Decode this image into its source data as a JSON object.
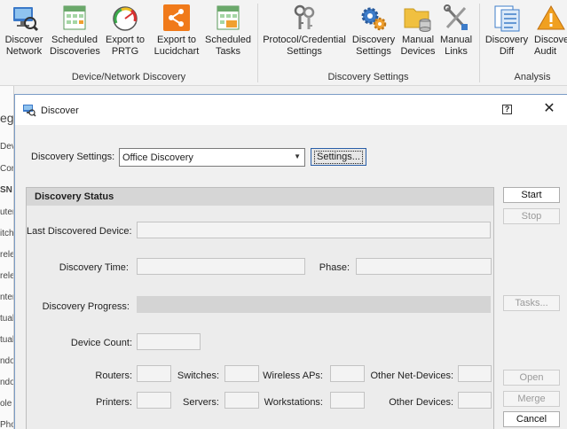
{
  "ribbon": {
    "buttons": [
      {
        "label": "Discover\nNetwork",
        "icon": "discover-network-icon"
      },
      {
        "label": "Scheduled\nDiscoveries",
        "icon": "scheduled-discoveries-icon"
      },
      {
        "label": "Export to\nPRTG",
        "icon": "prtg-gauge-icon"
      },
      {
        "label": "Export to\nLucidchart",
        "icon": "lucidchart-share-icon"
      },
      {
        "label": "Scheduled\nTasks",
        "icon": "scheduled-tasks-icon"
      },
      {
        "label": "Protocol/Credential\nSettings",
        "icon": "keys-icon"
      },
      {
        "label": "Discovery\nSettings",
        "icon": "gears-icon"
      },
      {
        "label": "Manual\nDevices",
        "icon": "folder-database-icon"
      },
      {
        "label": "Manual\nLinks",
        "icon": "tools-icon"
      },
      {
        "label": "Discovery\nDiff",
        "icon": "diff-icon"
      },
      {
        "label": "Discove\nAudit",
        "icon": "warning-icon"
      }
    ],
    "groups": [
      "Device/Network Discovery",
      "Discovery Settings",
      "Analysis"
    ]
  },
  "background_list": [
    "eg",
    "Dev",
    "Cor",
    "SN",
    "uter",
    "itch",
    "rele",
    "rele",
    "nter",
    "tual",
    "tual",
    "ndo",
    "ndo",
    "ole",
    "Pho"
  ],
  "dialog": {
    "title": "Discover",
    "help": "?",
    "close": "✕",
    "settings_label": "Discovery Settings:",
    "settings_value": "Office Discovery",
    "settings_button": "Settings...",
    "status_header": "Discovery Status",
    "fields": {
      "last_device": "Last Discovered Device:",
      "time": "Discovery Time:",
      "phase": "Phase:",
      "progress": "Discovery Progress:",
      "device_count": "Device Count:",
      "routers": "Routers:",
      "switches": "Switches:",
      "wireless": "Wireless APs:",
      "other_net": "Other Net-Devices:",
      "printers": "Printers:",
      "servers": "Servers:",
      "workstations": "Workstations:",
      "other_devices": "Other Devices:"
    },
    "buttons": {
      "start": "Start",
      "stop": "Stop",
      "tasks": "Tasks...",
      "open": "Open",
      "merge": "Merge",
      "cancel": "Cancel"
    }
  }
}
